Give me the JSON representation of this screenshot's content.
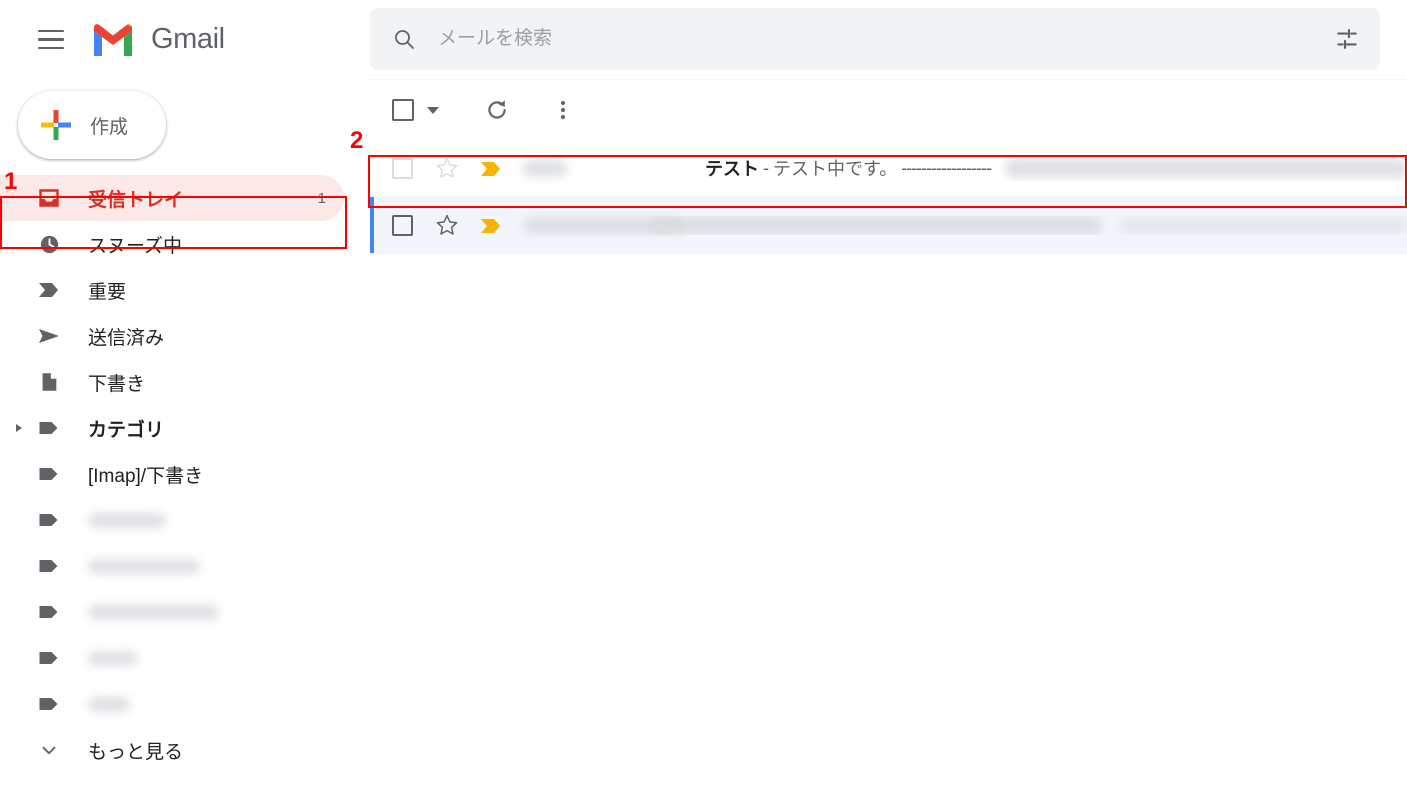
{
  "app": {
    "name": "Gmail",
    "logo_colors": {
      "red": "#ea4335",
      "blue": "#4285f4",
      "green": "#34a853",
      "yellow": "#fbbc04"
    }
  },
  "header": {
    "menu_icon": "hamburger-menu-icon",
    "brand_label": "Gmail"
  },
  "search": {
    "icon": "search-icon",
    "placeholder": "メールを検索",
    "value": "",
    "options_icon": "tune-filter-icon"
  },
  "sidebar": {
    "compose": {
      "label": "作成",
      "icon": "plus-icon"
    },
    "items": [
      {
        "label": "受信トレイ",
        "icon": "inbox-icon",
        "count": "1",
        "active": true,
        "bold": true,
        "blurred": false,
        "expandable": false
      },
      {
        "label": "スヌーズ中",
        "icon": "clock-icon",
        "count": "",
        "active": false,
        "bold": false,
        "blurred": false,
        "expandable": false
      },
      {
        "label": "重要",
        "icon": "important-marker-icon",
        "count": "",
        "active": false,
        "bold": false,
        "blurred": false,
        "expandable": false
      },
      {
        "label": "送信済み",
        "icon": "send-icon",
        "count": "",
        "active": false,
        "bold": false,
        "blurred": false,
        "expandable": false
      },
      {
        "label": "下書き",
        "icon": "draft-document-icon",
        "count": "",
        "active": false,
        "bold": false,
        "blurred": false,
        "expandable": false
      },
      {
        "label": "カテゴリ",
        "icon": "label-tag-icon",
        "count": "",
        "active": false,
        "bold": true,
        "blurred": false,
        "expandable": true
      },
      {
        "label": "[Imap]/下書き",
        "icon": "label-tag-icon",
        "count": "",
        "active": false,
        "bold": false,
        "blurred": false,
        "expandable": false
      },
      {
        "label": "",
        "icon": "label-tag-icon",
        "count": "",
        "active": false,
        "bold": false,
        "blurred": true,
        "blur_width": 78,
        "expandable": false
      },
      {
        "label": "",
        "icon": "label-tag-icon",
        "count": "",
        "active": false,
        "bold": false,
        "blurred": true,
        "blur_width": 112,
        "expandable": false
      },
      {
        "label": "",
        "icon": "label-tag-icon",
        "count": "",
        "active": false,
        "bold": false,
        "blurred": true,
        "blur_width": 131,
        "expandable": false
      },
      {
        "label": "",
        "icon": "label-tag-icon",
        "count": "",
        "active": false,
        "bold": false,
        "blurred": true,
        "blur_width": 50,
        "expandable": false
      },
      {
        "label": "",
        "icon": "label-tag-icon",
        "count": "",
        "active": false,
        "bold": false,
        "blurred": true,
        "blur_width": 42,
        "expandable": false
      }
    ],
    "more": {
      "label": "もっと見る",
      "icon": "chevron-down-icon"
    }
  },
  "toolbar": {
    "select_all_checkbox": "select-all-checkbox",
    "select_all_caret": "select-all-dropdown-caret",
    "refresh_label": "refresh-icon",
    "overflow_label": "more-options-icon"
  },
  "mail_list": {
    "rows": [
      {
        "state": "read",
        "checkbox": "row-checkbox",
        "star": "star-outline-icon",
        "important": "important-marker-icon",
        "sender_blurred": true,
        "sender_width": 44,
        "subject": "テスト",
        "separator": "-",
        "snippet": "テスト中です。",
        "snippet_dashes": "------------------",
        "body_blurred": true
      },
      {
        "state": "unread",
        "checkbox": "row-checkbox",
        "star": "star-outline-icon",
        "important": "important-marker-icon",
        "sender_blurred": true,
        "sender_width": 160,
        "subject": "",
        "separator": "",
        "snippet": "",
        "snippet_dashes": "",
        "body_blurred": true
      }
    ]
  },
  "annotations": [
    {
      "number": "1",
      "target": "sidebar-inbox-item"
    },
    {
      "number": "2",
      "target": "first-mail-row"
    }
  ],
  "colors": {
    "annotation_red": "#ff0000",
    "active_nav_bg": "#fce8e6",
    "active_nav_text": "#d93025",
    "unread_row_bg": "#f2f6fc",
    "unread_marker": "#4285f4",
    "important_marker": "#f4b400",
    "search_bg": "#f1f3f4"
  }
}
